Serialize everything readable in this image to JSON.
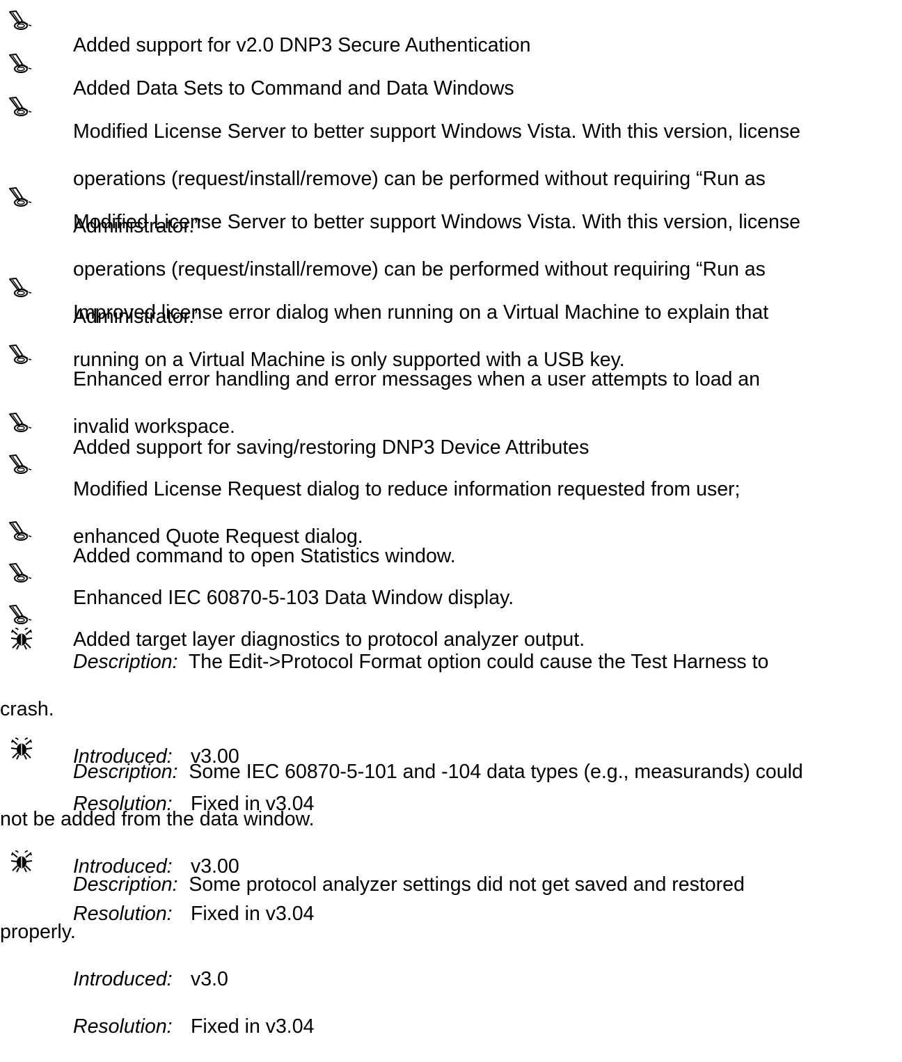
{
  "enhancements": [
    {
      "lines": [
        "Added support for v2.0 DNP3 Secure Authentication"
      ]
    },
    {
      "lines": [
        "Added Data Sets to Command and Data Windows"
      ]
    },
    {
      "lines": [
        "Modified License Server to better support Windows Vista. With this version, license",
        "operations (request/install/remove) can be performed without requiring “Run as",
        "Administrator.”"
      ]
    },
    {
      "lines": [
        "Modified License Server to better support Windows Vista. With this version, license",
        "operations (request/install/remove) can be performed without requiring “Run as",
        "Administrator.”"
      ]
    },
    {
      "lines": [
        "Improved license error dialog when running on a Virtual Machine to explain that",
        "running on a Virtual Machine is only supported with a USB key."
      ]
    },
    {
      "lines": [
        "Enhanced error handling and error messages when a user attempts to load an",
        "invalid workspace."
      ]
    },
    {
      "lines": [
        "Added support for saving/restoring DNP3 Device Attributes"
      ]
    },
    {
      "lines": [
        "Modified License Request dialog to reduce information requested from user;",
        "enhanced Quote Request dialog."
      ]
    },
    {
      "lines": [
        "Added command to open Statistics window."
      ]
    },
    {
      "lines": [
        "Enhanced IEC 60870-5-103 Data Window display."
      ]
    },
    {
      "lines": [
        "Added target layer diagnostics to protocol analyzer output."
      ]
    }
  ],
  "labels": {
    "description": "Description:",
    "introduced": "Introduced:",
    "resolution": "Resolution:"
  },
  "bugs": [
    {
      "description_first": "The Edit->Protocol Format option could cause the Test Harness to",
      "description_wrap": "crash.",
      "introduced": "v3.00",
      "resolution": "Fixed in v3.04"
    },
    {
      "description_first": "Some IEC 60870-5-101 and -104 data types (e.g., measurands) could",
      "description_wrap": "not be added from the data window.",
      "introduced": "v3.00",
      "resolution": "Fixed in v3.04"
    },
    {
      "description_first": "Some protocol analyzer settings did not get saved and restored",
      "description_wrap": "properly.",
      "introduced": "v3.0",
      "resolution": "Fixed in v3.04"
    }
  ],
  "icons": {
    "enhancement": "horn-icon",
    "bug": "bug-icon"
  }
}
